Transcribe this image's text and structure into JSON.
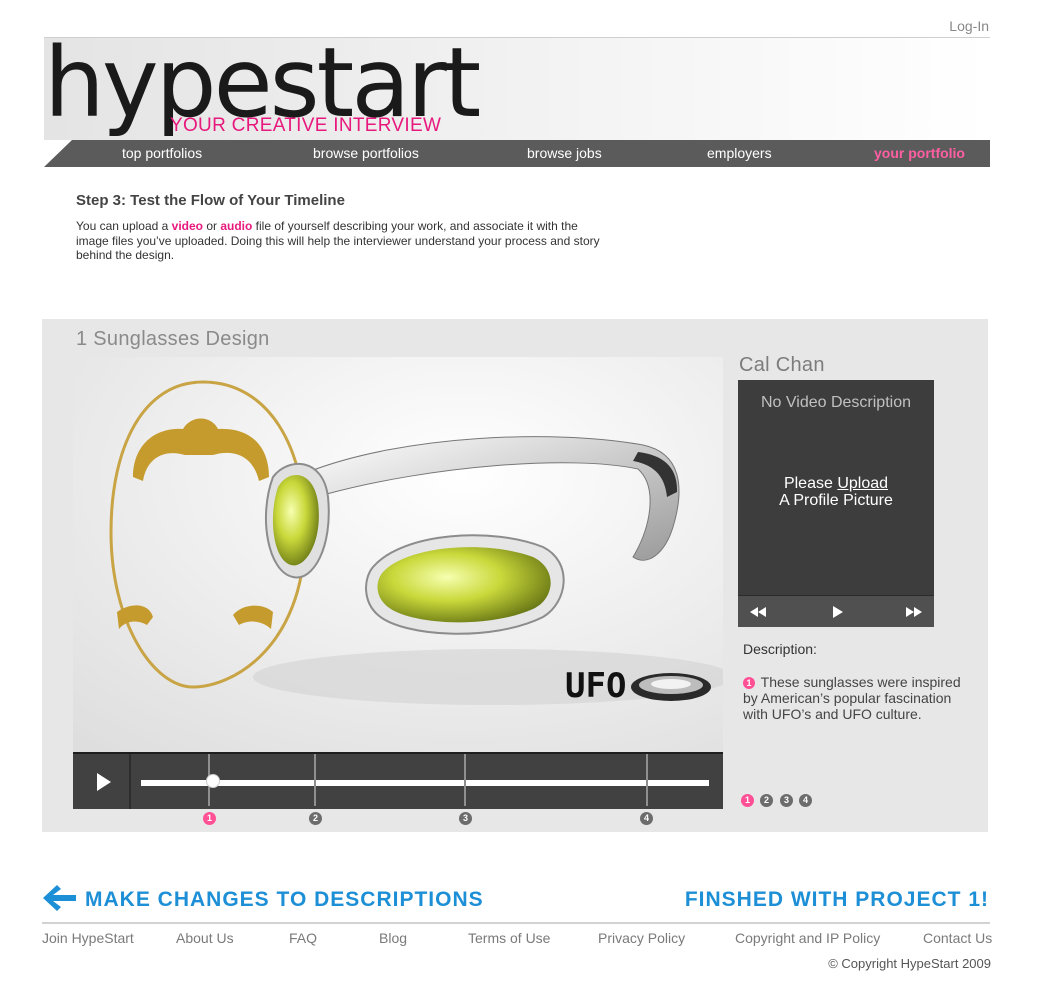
{
  "header": {
    "login_label": "Log-In",
    "logo_text": "hypestart",
    "tagline": "YOUR CREATIVE INTERVIEW"
  },
  "nav": {
    "items": [
      {
        "label": "top portfolios"
      },
      {
        "label": "browse portfolios"
      },
      {
        "label": "browse jobs"
      },
      {
        "label": "employers"
      },
      {
        "label": "your portfolio",
        "active": true
      }
    ],
    "active_color": "#ff5fa2"
  },
  "step": {
    "title": "Step 3: Test the Flow of Your Timeline",
    "text_before": "You can upload a ",
    "video_word": "video",
    "or_word": " or ",
    "audio_word": "audio",
    "text_after": " file of yourself describing your work, and associate it with the image files you’ve uploaded. Doing this will help the interviewer understand your process and story behind the design."
  },
  "project": {
    "title": "1 Sunglasses Design",
    "image_label": "UFO",
    "timeline_markers": [
      "1",
      "2",
      "3",
      "4"
    ],
    "active_marker": "1"
  },
  "profile": {
    "name": "Cal Chan",
    "no_video": "No Video Description",
    "please": "Please ",
    "upload_link": "Upload",
    "profile_picture": "A Profile Picture",
    "description_label": "Description:",
    "description_number": "1",
    "description_text": "These sunglasses were inspired by American’s popular fascination with UFO’s and UFO culture.",
    "pager": [
      "1",
      "2",
      "3",
      "4"
    ]
  },
  "actions": {
    "make_changes": "MAKE CHANGES TO DESCRIPTIONS",
    "finished": "FINSHED WITH PROJECT 1!"
  },
  "footer": {
    "links": [
      "Join HypeStart",
      "About Us",
      "FAQ",
      "Blog",
      "Terms of Use",
      "Privacy Policy",
      "Copyright and IP Policy",
      "Contact Us"
    ],
    "copyright": "©  Copyright HypeStart 2009"
  },
  "colors": {
    "accent_pink": "#e8197d",
    "action_blue": "#1d8fd6",
    "nav_bg": "#5b5b5b"
  }
}
